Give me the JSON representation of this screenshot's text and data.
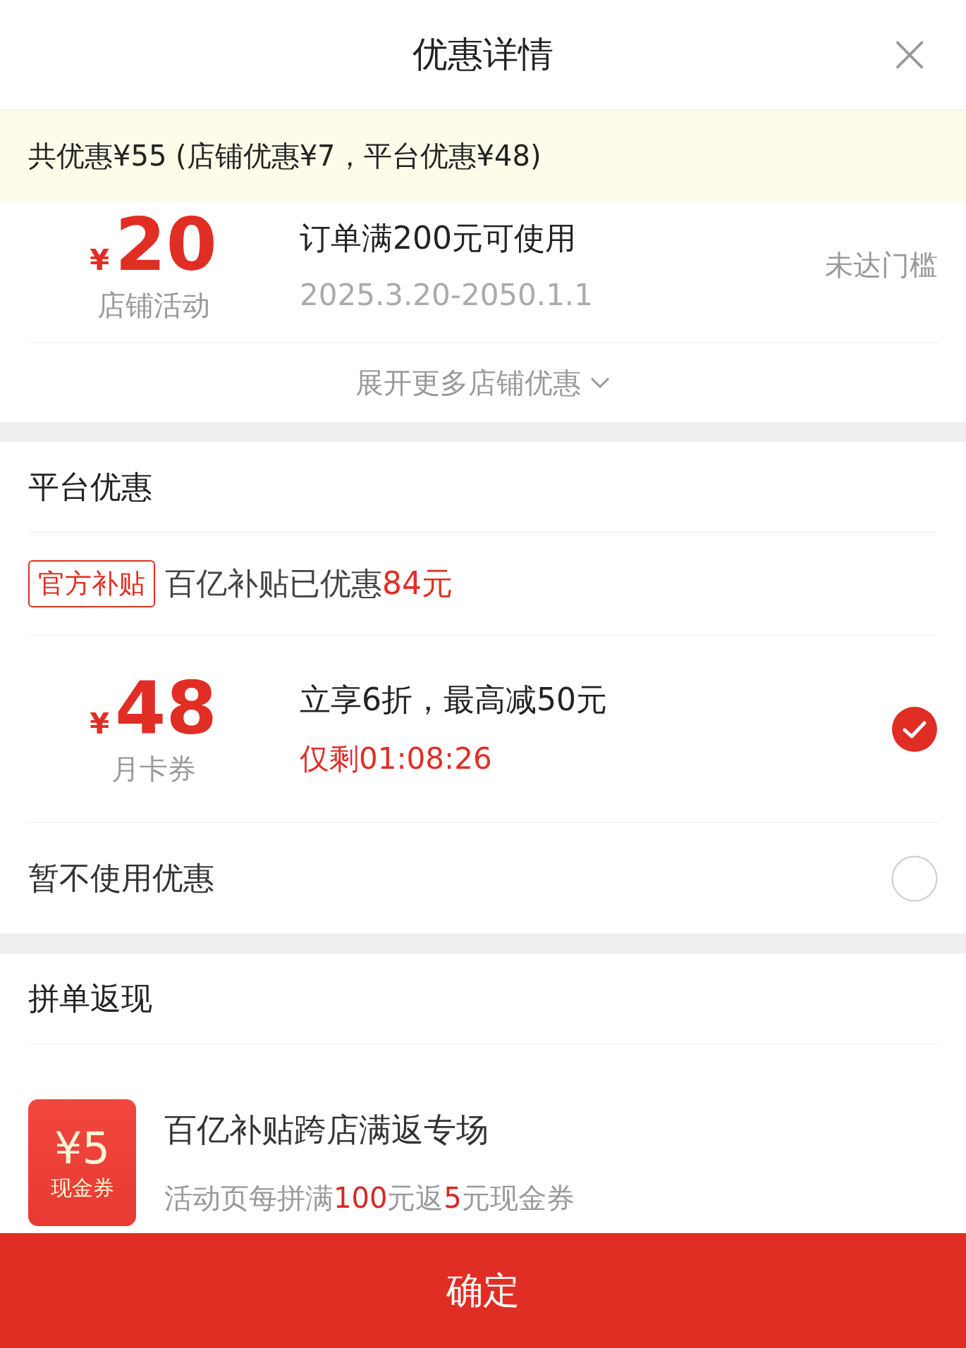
{
  "header": {
    "title": "优惠详情",
    "close": "×"
  },
  "summary": "共优惠¥55 (店铺优惠¥7，平台优惠¥48)",
  "store_coupons": [
    {
      "currency": "¥",
      "amount": "20",
      "label": "店铺活动",
      "title": "订单满200元可使用",
      "detail": "2025.3.20-2050.1.1",
      "urgent": false,
      "status": "未达门槛"
    }
  ],
  "expand": {
    "label": "展开更多店铺优惠"
  },
  "platform": {
    "title": "平台优惠",
    "tag": "官方补贴",
    "subsidy": {
      "text": "百亿补贴已优惠",
      "highlight": "84元"
    },
    "coupons": [
      {
        "currency": "¥",
        "amount": "48",
        "label": "月卡券",
        "title": "立享6折，最高减50元",
        "detail": "仅剩01:08:26",
        "urgent": true,
        "selected": true
      }
    ],
    "none_option": {
      "label": "暂不使用优惠",
      "selected": false
    }
  },
  "cashback": {
    "title": "拼单返现",
    "badge_amount": "¥5",
    "badge_label": "现金券",
    "name": "百亿补贴跨店满返专场",
    "description": [
      {
        "text": "活动页每拼满",
        "highlight": false
      },
      {
        "text": "100",
        "highlight": true
      },
      {
        "text": "元返",
        "highlight": false
      },
      {
        "text": "5",
        "highlight": true
      },
      {
        "text": "元现金券",
        "highlight": false
      }
    ]
  },
  "confirm": "确定"
}
